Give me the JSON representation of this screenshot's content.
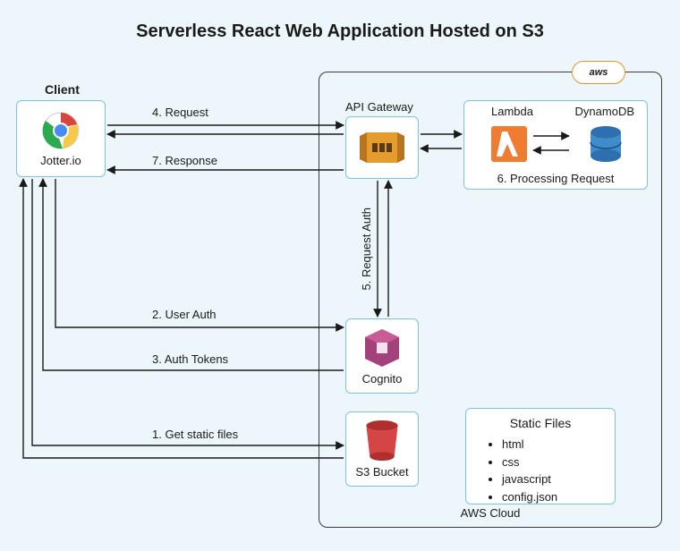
{
  "title": "Serverless React Web Application Hosted on S3",
  "client_heading": "Client",
  "client_name": "Jotter.io",
  "aws": {
    "badge": "aws",
    "caption": "AWS Cloud",
    "api_gateway": "API Gateway",
    "lambda": "Lambda",
    "dynamodb": "DynamoDB",
    "processing_caption": "6. Processing Request",
    "cognito": "Cognito",
    "s3": "S3 Bucket",
    "static_files": {
      "title": "Static Files",
      "items": [
        "html",
        "css",
        "javascript",
        "config.json"
      ]
    }
  },
  "flows": {
    "f1": "1. Get static files",
    "f2": "2. User Auth",
    "f3": "3. Auth Tokens",
    "f4": "4. Request",
    "f5": "5. Request Auth",
    "f7": "7. Response"
  }
}
